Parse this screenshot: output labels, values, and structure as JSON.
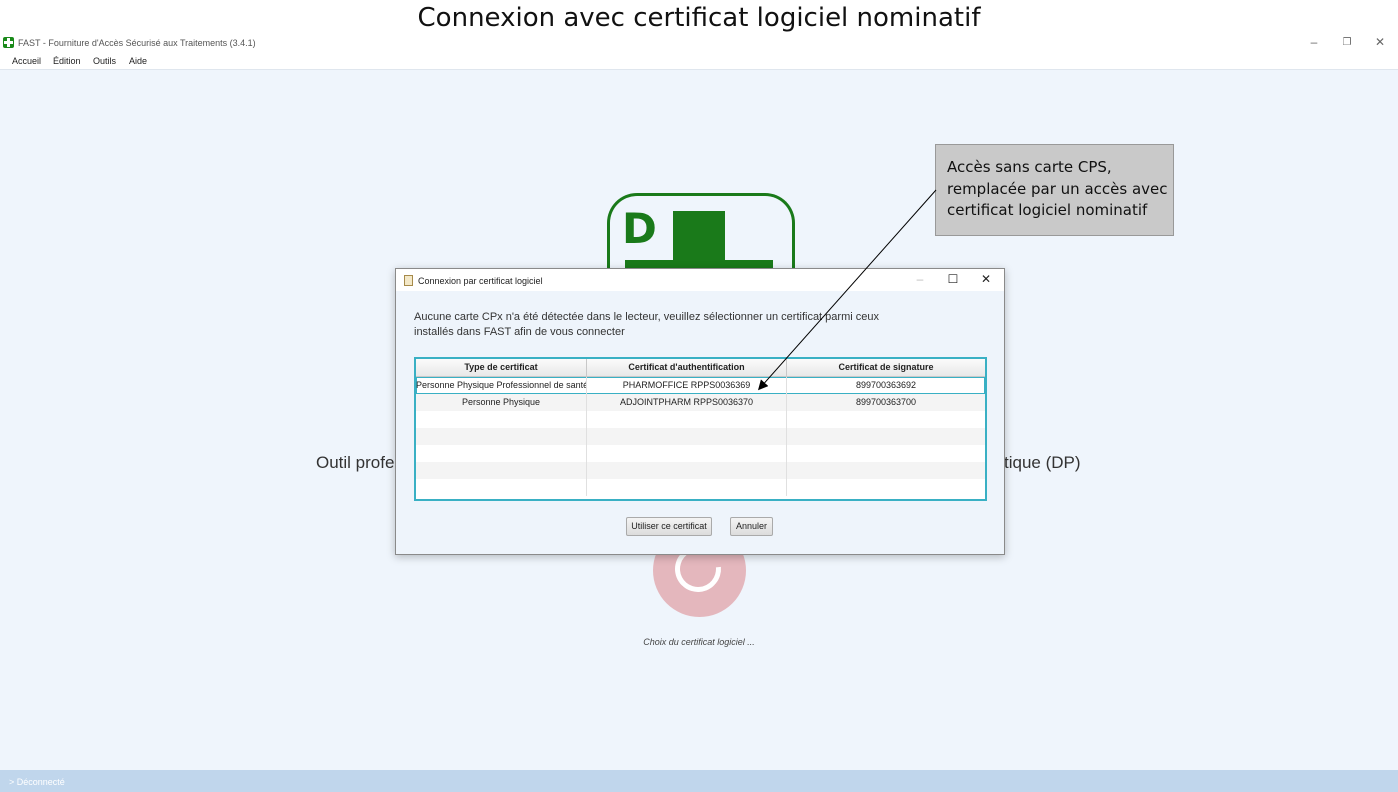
{
  "slide": {
    "title": "Connexion avec certificat logiciel nominatif"
  },
  "app": {
    "title": "FAST - Fourniture d'Accès Sécurisé aux Traitements (3.4.1)",
    "window_controls": {
      "minimize": "–",
      "restore": "❐",
      "close": "✕"
    },
    "menu": [
      "Accueil",
      "Édition",
      "Outils",
      "Aide"
    ],
    "background_text_left": "Outil profe",
    "background_text_right": "tique (DP)",
    "logo_letter": "D",
    "choice_label": "Choix du certificat logiciel ...",
    "status": "> Déconnecté"
  },
  "dialog": {
    "title": "Connexion par certificat logiciel",
    "controls": {
      "minimize": "–",
      "maximize": "☐",
      "close": "✕"
    },
    "message_line1": "Aucune carte CPx n'a été détectée dans le lecteur, veuillez sélectionner un certificat parmi ceux",
    "message_line2": "installés dans FAST afin de vous connecter",
    "columns": [
      "Type de certificat",
      "Certificat d'authentification",
      "Certificat de signature"
    ],
    "rows": [
      [
        "Personne Physique Professionnel de santé",
        "PHARMOFFICE RPPS0036369",
        "899700363692"
      ],
      [
        "Personne Physique",
        "ADJOINTPHARM RPPS0036370",
        "899700363700"
      ]
    ],
    "buttons": {
      "use": "Utiliser ce certificat",
      "cancel": "Annuler"
    }
  },
  "callout": {
    "line1": "Accès sans carte CPS,",
    "line2": "remplacée par un accès avec",
    "line3": "certificat logiciel nominatif"
  }
}
